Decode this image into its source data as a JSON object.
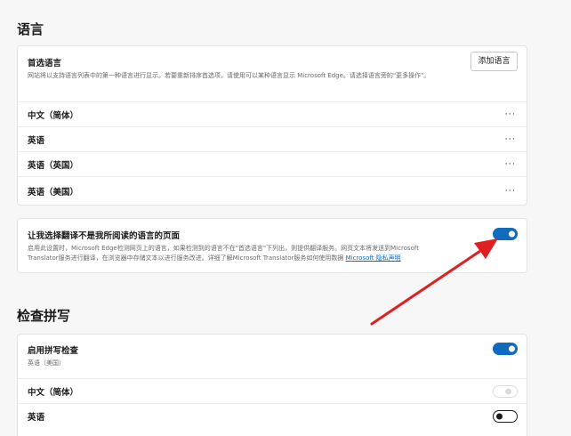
{
  "language_section": {
    "title": "语言",
    "preferred": {
      "title": "首选语言",
      "description": "网站将以支持语言列表中的第一种语言进行显示。若要重新排序首选项，请使用可以某种语言显示 Microsoft Edge。请选择语言旁的\"更多操作\"。",
      "add_button": "添加语言"
    },
    "languages": [
      {
        "label": "中文（简体）",
        "more": "···"
      },
      {
        "label": "英语",
        "more": "···"
      },
      {
        "label": "英语（英国）",
        "more": "···"
      },
      {
        "label": "英语（美国）",
        "more": "···"
      }
    ]
  },
  "translate_card": {
    "title": "让我选择翻译不是我所阅读的语言的页面",
    "description_line1": "启用此设置时，Microsoft Edge检测网页上的语言，如果检测到的语言不在\"首选语言\"下列出，则提供翻译服务。网页文本将发送到Microsoft",
    "description_line2": "Translator服务进行翻译，在浏览器中存储文本以进行服务改进。详细了解Microsoft Translator服务如何使用数据",
    "link": "Microsoft 隐私声明",
    "toggle_state": "on"
  },
  "spellcheck_section": {
    "title": "检查拼写",
    "enable": {
      "title": "启用拼写检查",
      "subtitle": "英语（美国）",
      "toggle_state": "on"
    },
    "languages": [
      {
        "label": "中文（简体）",
        "toggle_state": "disabled"
      },
      {
        "label": "英语",
        "toggle_state": "off"
      }
    ]
  },
  "colors": {
    "accent": "#0f6cbd",
    "annotation_arrow": "#e02020"
  }
}
